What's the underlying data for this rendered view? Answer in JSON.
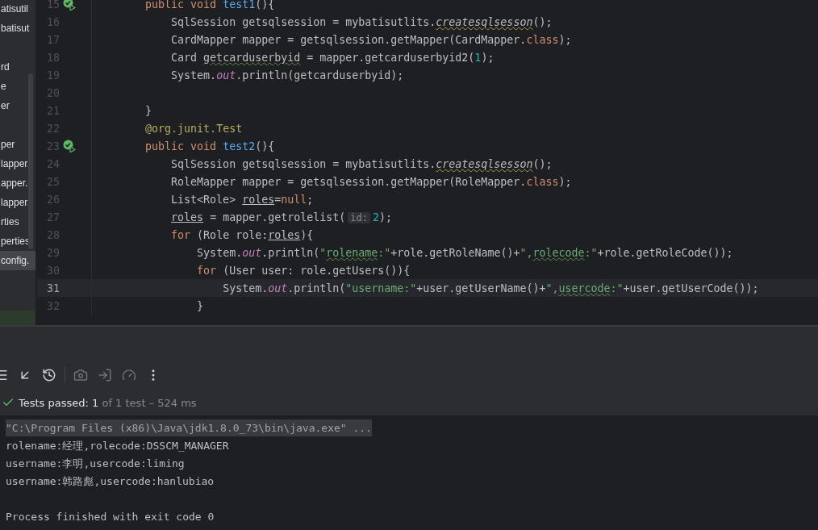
{
  "project_tree": {
    "items": [
      {
        "kind": "entry",
        "label": "atisutil",
        "selected": false
      },
      {
        "kind": "entry",
        "label": "batisut",
        "selected": false
      },
      {
        "kind": "blank",
        "selected": false
      },
      {
        "kind": "entry",
        "label": "rd",
        "selected": false
      },
      {
        "kind": "entry",
        "label": "e",
        "selected": false
      },
      {
        "kind": "entry",
        "label": "er",
        "selected": false
      },
      {
        "kind": "blank",
        "selected": false
      },
      {
        "kind": "entry",
        "label": "per",
        "selected": false
      },
      {
        "kind": "entry",
        "label": "lapper.",
        "selected": false
      },
      {
        "kind": "entry",
        "label": "apper.",
        "selected": false
      },
      {
        "kind": "entry",
        "label": "lapper.",
        "selected": false
      },
      {
        "kind": "entry",
        "label": "rties",
        "selected": false
      },
      {
        "kind": "entry",
        "label": "perties",
        "selected": false
      },
      {
        "kind": "entry",
        "label": "config.",
        "selected": true
      }
    ]
  },
  "editor": {
    "lines": [
      {
        "number": "15",
        "current": false,
        "run_marker": true,
        "tokens": [
          {
            "text": "    public void ",
            "kind": "keyword"
          },
          {
            "text": "test1",
            "kind": "method"
          },
          {
            "text": "(){",
            "kind": "plain"
          }
        ]
      },
      {
        "number": "16",
        "current": false,
        "run_marker": false,
        "tokens": [
          {
            "text": "        SqlSession getsqlsession = mybatisutlits.",
            "kind": "plain"
          },
          {
            "text": "createsqlsesson",
            "kind": "static_typo"
          },
          {
            "text": "();",
            "kind": "plain"
          }
        ]
      },
      {
        "number": "17",
        "current": false,
        "run_marker": false,
        "tokens": [
          {
            "text": "        CardMapper mapper = getsqlsession.getMapper(CardMapper.",
            "kind": "plain"
          },
          {
            "text": "class",
            "kind": "keyword"
          },
          {
            "text": ");",
            "kind": "plain"
          }
        ]
      },
      {
        "number": "18",
        "current": false,
        "run_marker": false,
        "tokens": [
          {
            "text": "        Card ",
            "kind": "plain"
          },
          {
            "text": "getcarduserbyid",
            "kind": "typo"
          },
          {
            "text": " = mapper.getcarduserbyid2(",
            "kind": "plain"
          },
          {
            "text": "1",
            "kind": "number"
          },
          {
            "text": ");",
            "kind": "plain"
          }
        ]
      },
      {
        "number": "19",
        "current": false,
        "run_marker": false,
        "tokens": [
          {
            "text": "        System.",
            "kind": "plain"
          },
          {
            "text": "out",
            "kind": "field"
          },
          {
            "text": ".println(getcarduserbyid);",
            "kind": "plain"
          }
        ]
      },
      {
        "number": "20",
        "current": false,
        "run_marker": false
      },
      {
        "number": "21",
        "current": false,
        "run_marker": false,
        "tokens": [
          {
            "text": "    }",
            "kind": "plain"
          }
        ]
      },
      {
        "number": "22",
        "current": false,
        "run_marker": false,
        "tokens": [
          {
            "text": "    @org.junit.",
            "kind": "annotation"
          },
          {
            "text": "Test",
            "kind": "annotation_name"
          }
        ]
      },
      {
        "number": "23",
        "current": false,
        "run_marker": true,
        "tokens": [
          {
            "text": "    public void ",
            "kind": "keyword"
          },
          {
            "text": "test2",
            "kind": "method"
          },
          {
            "text": "(){",
            "kind": "plain"
          }
        ]
      },
      {
        "number": "24",
        "current": false,
        "run_marker": false,
        "tokens": [
          {
            "text": "        SqlSession getsqlsession = mybatisutlits.",
            "kind": "plain"
          },
          {
            "text": "createsqlsesson",
            "kind": "static_typo"
          },
          {
            "text": "();",
            "kind": "plain"
          }
        ]
      },
      {
        "number": "25",
        "current": false,
        "run_marker": false,
        "tokens": [
          {
            "text": "        RoleMapper mapper = getsqlsession.getMapper(RoleMapper.",
            "kind": "plain"
          },
          {
            "text": "class",
            "kind": "keyword"
          },
          {
            "text": ");",
            "kind": "plain"
          }
        ]
      },
      {
        "number": "26",
        "current": false,
        "run_marker": false,
        "tokens": [
          {
            "text": "        List<Role> ",
            "kind": "plain"
          },
          {
            "text": "roles",
            "kind": "reassigned"
          },
          {
            "text": "=",
            "kind": "plain"
          },
          {
            "text": "null",
            "kind": "keyword"
          },
          {
            "text": ";",
            "kind": "plain"
          }
        ]
      },
      {
        "number": "27",
        "current": false,
        "run_marker": false,
        "tokens": [
          {
            "text": "        roles",
            "kind": "reassigned"
          },
          {
            "text": " = mapper.getrolelist(",
            "kind": "plain"
          },
          {
            "text": "id:",
            "kind": "hint"
          },
          {
            "text": "2",
            "kind": "number"
          },
          {
            "text": ");",
            "kind": "plain"
          }
        ]
      },
      {
        "number": "28",
        "current": false,
        "run_marker": false,
        "tokens": [
          {
            "text": "        for ",
            "kind": "keyword"
          },
          {
            "text": "(Role role:",
            "kind": "plain"
          },
          {
            "text": "roles",
            "kind": "reassigned"
          },
          {
            "text": "){",
            "kind": "plain"
          }
        ]
      },
      {
        "number": "29",
        "current": false,
        "run_marker": false,
        "tokens": [
          {
            "text": "            System.",
            "kind": "plain"
          },
          {
            "text": "out",
            "kind": "field"
          },
          {
            "text": ".println(",
            "kind": "plain"
          },
          {
            "text": "\"",
            "kind": "string"
          },
          {
            "text": "rolename",
            "kind": "string_typo"
          },
          {
            "text": ":\"",
            "kind": "string"
          },
          {
            "text": "+role.getRoleName()+",
            "kind": "plain"
          },
          {
            "text": "\",",
            "kind": "string"
          },
          {
            "text": "rolecode",
            "kind": "string_typo"
          },
          {
            "text": ":\"",
            "kind": "string"
          },
          {
            "text": "+role.getRoleCode());",
            "kind": "plain"
          }
        ]
      },
      {
        "number": "30",
        "current": false,
        "run_marker": false,
        "tokens": [
          {
            "text": "            for ",
            "kind": "keyword"
          },
          {
            "text": "(User user: role.getUsers()){",
            "kind": "plain"
          }
        ]
      },
      {
        "number": "31",
        "current": true,
        "run_marker": false,
        "tokens": [
          {
            "text": "                System.",
            "kind": "plain"
          },
          {
            "text": "out",
            "kind": "field"
          },
          {
            "text": ".println(",
            "kind": "plain"
          },
          {
            "text": "\"username:\"",
            "kind": "string"
          },
          {
            "text": "+user.getUserName()+",
            "kind": "plain"
          },
          {
            "text": "\",",
            "kind": "string"
          },
          {
            "text": "usercode",
            "kind": "string_typo"
          },
          {
            "text": ":\"",
            "kind": "string"
          },
          {
            "text": "+user.getUserCode());",
            "kind": "plain"
          }
        ]
      },
      {
        "number": "32",
        "current": false,
        "run_marker": false,
        "tokens": [
          {
            "text": "            }",
            "kind": "plain"
          }
        ]
      }
    ]
  },
  "test_status": {
    "label": "Tests passed: 1",
    "detail": "of 1 test – 524 ms",
    "passed": true
  },
  "console": {
    "lines": [
      {
        "text": "\"C:\\Program Files (x86)\\Java\\jdk1.8.0_73\\bin\\java.exe\" ...",
        "kind": "command"
      },
      {
        "text": "rolename:经理,rolecode:DSSCM_MANAGER",
        "kind": "output"
      },
      {
        "text": "username:李明,usercode:liming",
        "kind": "output"
      },
      {
        "text": "username:韩路彪,usercode:hanlubiao",
        "kind": "output"
      },
      {
        "text": "Process finished with exit code 0",
        "kind": "exit"
      }
    ]
  }
}
